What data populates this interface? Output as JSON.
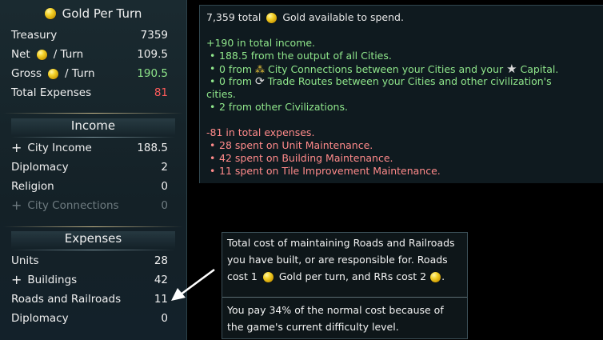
{
  "left": {
    "title": "Gold Per Turn",
    "summary": [
      {
        "label": "Treasury",
        "value": "7359"
      },
      {
        "label": "Net",
        "suffix": "/ Turn",
        "value": "109.5"
      },
      {
        "label": "Gross",
        "suffix": "/ Turn",
        "value": "190.5"
      },
      {
        "label": "Total Expenses",
        "value": "81"
      }
    ],
    "income": {
      "heading": "Income",
      "items": [
        {
          "prefix": "+",
          "label": "City Income",
          "value": "188.5"
        },
        {
          "label": "Diplomacy",
          "value": "2"
        },
        {
          "label": "Religion",
          "value": "0"
        },
        {
          "prefix": "+",
          "label": "City Connections",
          "value": "0"
        }
      ]
    },
    "expenses": {
      "heading": "Expenses",
      "items": [
        {
          "label": "Units",
          "value": "28"
        },
        {
          "prefix": "+",
          "label": "Buildings",
          "value": "42"
        },
        {
          "label": "Roads and Railroads",
          "value": "11"
        },
        {
          "label": "Diplomacy",
          "value": "0"
        }
      ]
    }
  },
  "details": {
    "total_prefix": "7,359 total",
    "total_suffix": "Gold available to spend.",
    "income_header": "+190 in total income.",
    "income_1": "188.5 from the output of all Cities.",
    "income_2a": "0 from",
    "income_2b": "City Connections between your Cities and your",
    "income_2c": "Capital.",
    "income_3a": "0 from",
    "income_3b": "Trade Routes between your Cities and other civilization's",
    "income_3c": "cities.",
    "income_4": "2 from other Civilizations.",
    "expense_header": "-81 in total expenses.",
    "expense_1": "28 spent on Unit Maintenance.",
    "expense_2": "42 spent on Building Maintenance.",
    "expense_3": "11 spent on Tile Improvement Maintenance."
  },
  "tooltip": {
    "line1": "Total cost of maintaining Roads and Railroads",
    "line2": "you have built, or are responsible for. Roads",
    "line3a": "cost 1",
    "line3b": "Gold per turn, and RRs cost 2",
    "line3c": ".",
    "line4": "You pay 34% of the normal cost because of",
    "line5": "the game's current difficulty level."
  },
  "colors": {
    "income_green": "#8fe68b",
    "expense_red": "#ff5b5b",
    "gold": "#f4d22b"
  },
  "icons": [
    "gold-coin-icon",
    "city-connection-icon",
    "capital-star-icon",
    "trade-route-icon",
    "pointer-arrow-icon"
  ]
}
